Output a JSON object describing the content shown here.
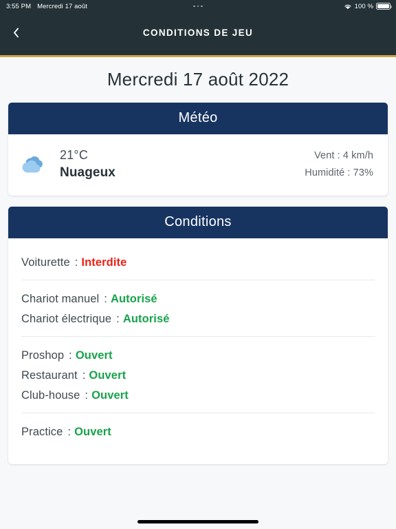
{
  "status_bar": {
    "time": "3:55 PM",
    "date": "Mercredi 17 août",
    "battery_percent": "100 %",
    "wifi_icon": "wifi-icon",
    "battery_icon": "battery-icon",
    "menu_dots_icon": "more-dots-icon"
  },
  "nav": {
    "back_icon": "chevron-left-icon",
    "title": "CONDITIONS DE JEU"
  },
  "page": {
    "date_title": "Mercredi 17 août 2022"
  },
  "weather": {
    "card_title": "Météo",
    "icon": "cloudy-icon",
    "temperature": "21°C",
    "description": "Nuageux",
    "wind": "Vent : 4 km/h",
    "humidity": "Humidité : 73%"
  },
  "conditions": {
    "card_title": "Conditions",
    "separator": ":",
    "groups": [
      {
        "rows": [
          {
            "label": "Voiturette",
            "value": "Interdite",
            "state": "denied"
          }
        ]
      },
      {
        "rows": [
          {
            "label": "Chariot manuel",
            "value": "Autorisé",
            "state": "allow"
          },
          {
            "label": "Chariot électrique",
            "value": "Autorisé",
            "state": "allow"
          }
        ]
      },
      {
        "rows": [
          {
            "label": "Proshop",
            "value": "Ouvert",
            "state": "open"
          },
          {
            "label": "Restaurant",
            "value": "Ouvert",
            "state": "open"
          },
          {
            "label": "Club-house",
            "value": "Ouvert",
            "state": "open"
          }
        ]
      },
      {
        "rows": [
          {
            "label": "Practice",
            "value": "Ouvert",
            "state": "open"
          }
        ]
      }
    ]
  },
  "colors": {
    "nav_background": "#243237",
    "nav_accent": "#c9a449",
    "card_header": "#173461",
    "page_background": "#f7f8f9",
    "open": "#16a34a",
    "denied": "#ee2015"
  }
}
